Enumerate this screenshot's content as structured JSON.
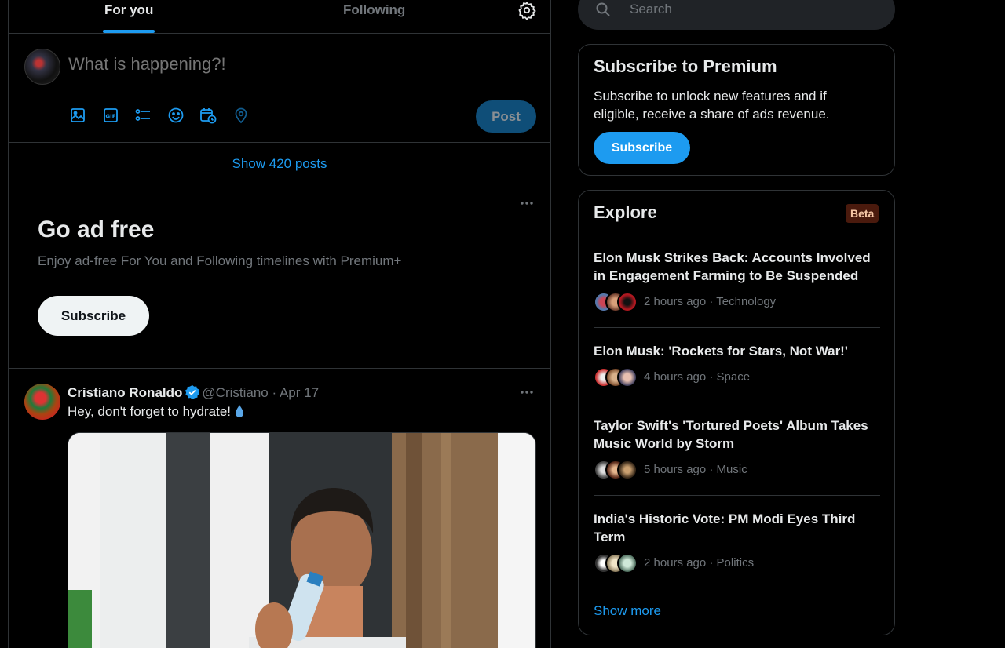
{
  "tabs": {
    "for_you": "For you",
    "following": "Following"
  },
  "composer": {
    "placeholder": "What is happening?!",
    "post_label": "Post"
  },
  "show_posts": "Show 420 posts",
  "ad_free": {
    "title": "Go ad free",
    "subtitle": "Enjoy ad-free For You and Following timelines with Premium+",
    "button": "Subscribe"
  },
  "tweet": {
    "name": "Cristiano Ronaldo",
    "handle": "@Cristiano",
    "separator": "·",
    "date": "Apr 17",
    "text": "Hey, don't forget to hydrate!"
  },
  "search": {
    "placeholder": "Search"
  },
  "premium": {
    "title": "Subscribe to Premium",
    "description": "Subscribe to unlock new features and if eligible, receive a share of ads revenue.",
    "button": "Subscribe"
  },
  "explore": {
    "title": "Explore",
    "badge": "Beta",
    "items": [
      {
        "title": "Elon Musk Strikes Back: Accounts Involved in Engagement Farming to Be Suspended",
        "meta": "2 hours ago · Technology"
      },
      {
        "title": "Elon Musk: 'Rockets for Stars, Not War!'",
        "meta": "4 hours ago · Space"
      },
      {
        "title": "Taylor Swift's 'Tortured Poets' Album Takes Music World by Storm",
        "meta": "5 hours ago · Music"
      },
      {
        "title": "India's Historic Vote: PM Modi Eyes Third Term",
        "meta": "2 hours ago · Politics"
      }
    ],
    "show_more": "Show more"
  },
  "colors": {
    "accent": "#1d9bf0",
    "background": "#000000",
    "border": "#2f3336",
    "muted": "#71767b",
    "text": "#e7e9ea"
  }
}
